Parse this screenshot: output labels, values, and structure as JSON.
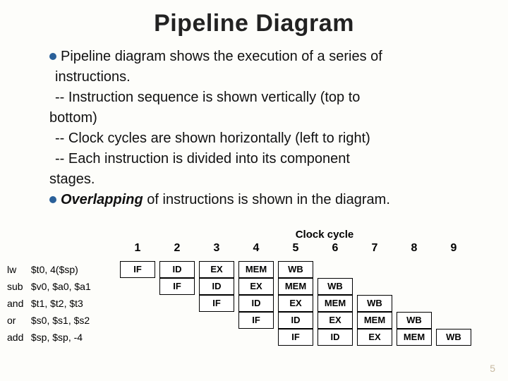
{
  "title": "Pipeline Diagram",
  "b1_lead": "Pipeline diagram shows the execution of a series of",
  "b1_tail": "instructions.",
  "d1a": "-- Instruction sequence is shown vertically (top to",
  "d1b": "bottom)",
  "d2": "-- Clock cycles are shown horizontally (left to right)",
  "d3a": "-- Each instruction is divided into its component",
  "d3b": "stages.",
  "b2_lead": "Overlapping",
  "b2_tail": " of instructions is shown in the diagram.",
  "clock_label": "Clock cycle",
  "cycles": [
    "1",
    "2",
    "3",
    "4",
    "5",
    "6",
    "7",
    "8",
    "9"
  ],
  "instr": [
    {
      "m": "lw",
      "o": "$t0, 4($sp)"
    },
    {
      "m": "sub",
      "o": "$v0, $a0, $a1"
    },
    {
      "m": "and",
      "o": "$t1, $t2, $t3"
    },
    {
      "m": "or",
      "o": "$s0, $s1, $s2"
    },
    {
      "m": "add",
      "o": "$sp, $sp, -4"
    }
  ],
  "stages": [
    "IF",
    "ID",
    "EX",
    "MEM",
    "WB"
  ],
  "page": "5"
}
